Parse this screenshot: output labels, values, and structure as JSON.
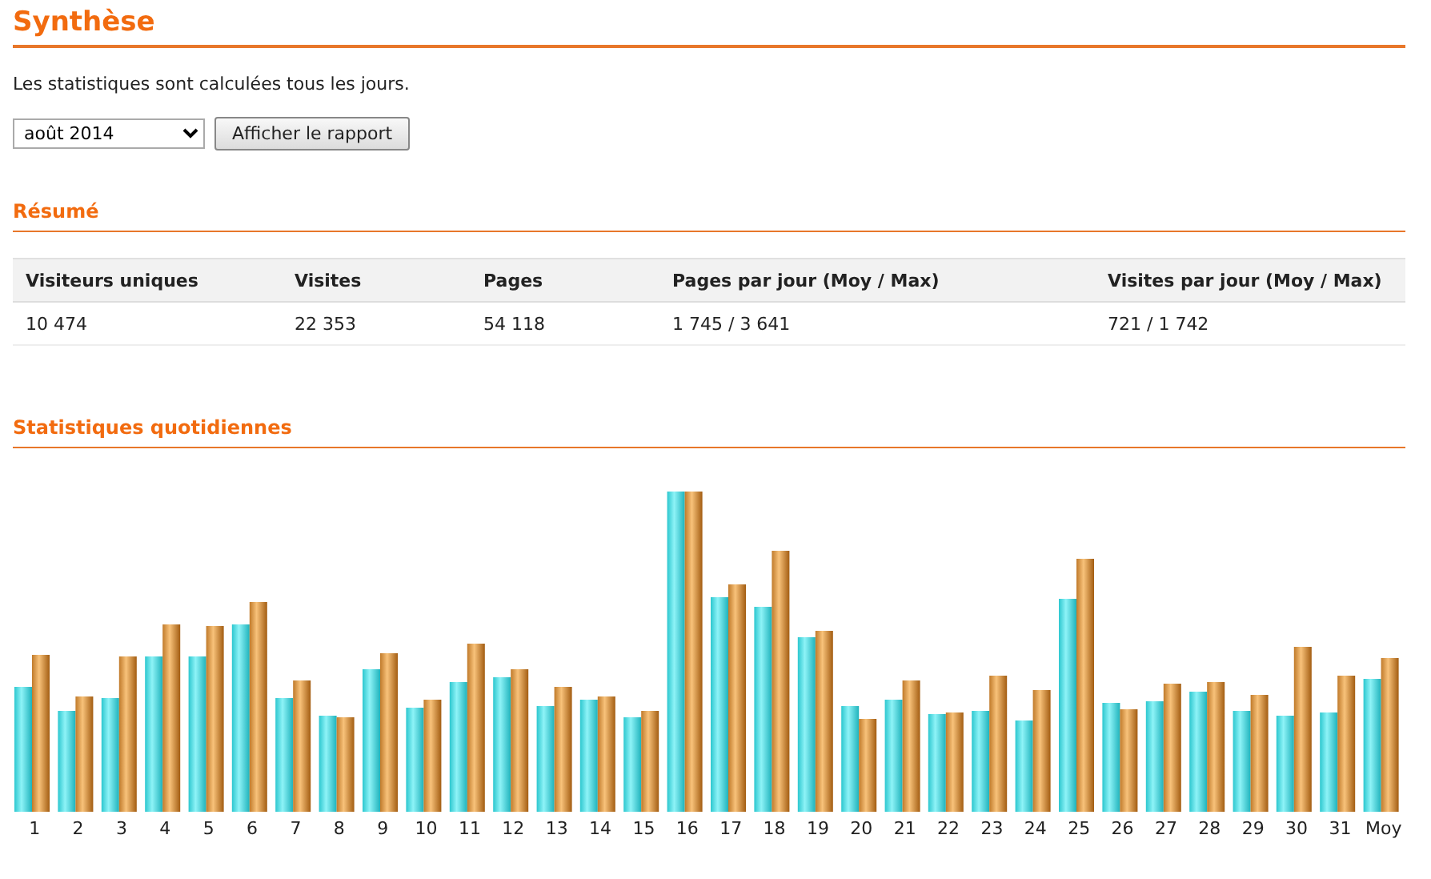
{
  "page_title": "Synthèse",
  "intro": "Les statistiques sont calculées tous les jours.",
  "period_select": {
    "value": "août 2014"
  },
  "report_button": "Afficher le rapport",
  "summary": {
    "heading": "Résumé",
    "columns": [
      "Visiteurs uniques",
      "Visites",
      "Pages",
      "Pages par jour (Moy / Max)",
      "Visites par jour (Moy / Max)"
    ],
    "rows": [
      [
        "10 474",
        "22 353",
        "54 118",
        "1 745 / 3 641",
        "721 / 1 742"
      ]
    ]
  },
  "daily": {
    "heading": "Statistiques quotidiennes",
    "categories": [
      "1",
      "2",
      "3",
      "4",
      "5",
      "6",
      "7",
      "8",
      "9",
      "10",
      "11",
      "12",
      "13",
      "14",
      "15",
      "16",
      "17",
      "18",
      "19",
      "20",
      "21",
      "22",
      "23",
      "24",
      "25",
      "26",
      "27",
      "28",
      "29",
      "30",
      "31",
      "Moy"
    ]
  }
}
